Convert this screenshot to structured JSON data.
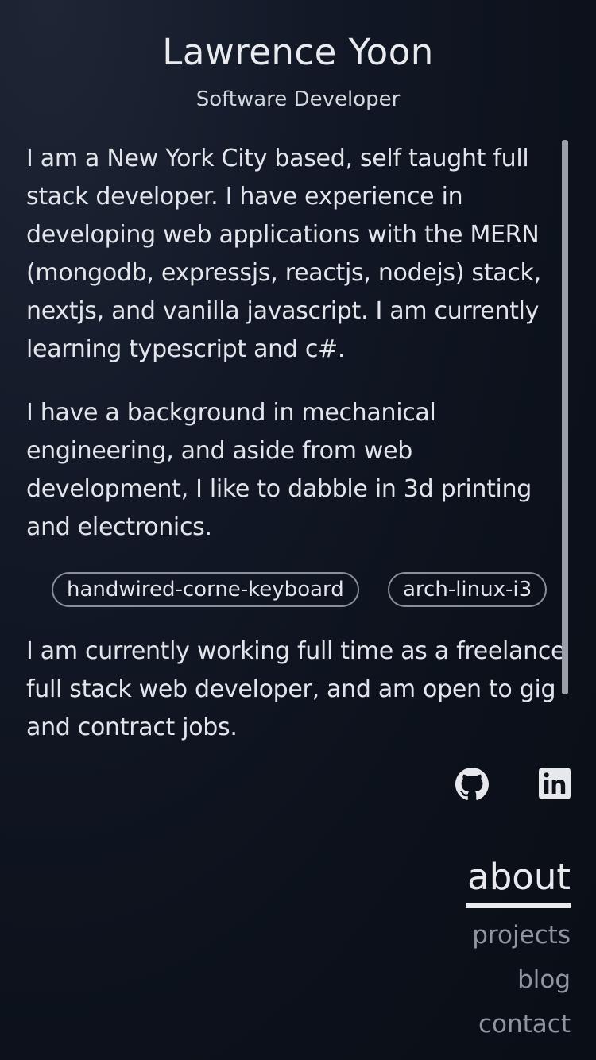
{
  "header": {
    "name": "Lawrence Yoon",
    "role": "Software Developer"
  },
  "about": {
    "paragraphs": [
      "I am a New York City based, self taught full stack developer. I have experience in developing web applications with the MERN (mongodb, expressjs, reactjs, nodejs) stack, nextjs, and vanilla javascript. I am currently learning typescript and c#.",
      "I have a background in mechanical engineering, and aside from web development, I like to dabble in 3d printing and electronics.",
      "I am currently working full time as a freelance full stack web developer, and am open to gig and contract jobs."
    ],
    "tags": [
      "handwired-corne-keyboard",
      "arch-linux-i3"
    ]
  },
  "social": {
    "icons": [
      "github-icon",
      "linkedin-icon"
    ]
  },
  "nav": {
    "items": [
      "about",
      "projects",
      "blog",
      "contact"
    ],
    "active": "about"
  },
  "colors": {
    "background": "#0c111b",
    "text": "#e2e5ea",
    "muted": "#9096a0"
  }
}
